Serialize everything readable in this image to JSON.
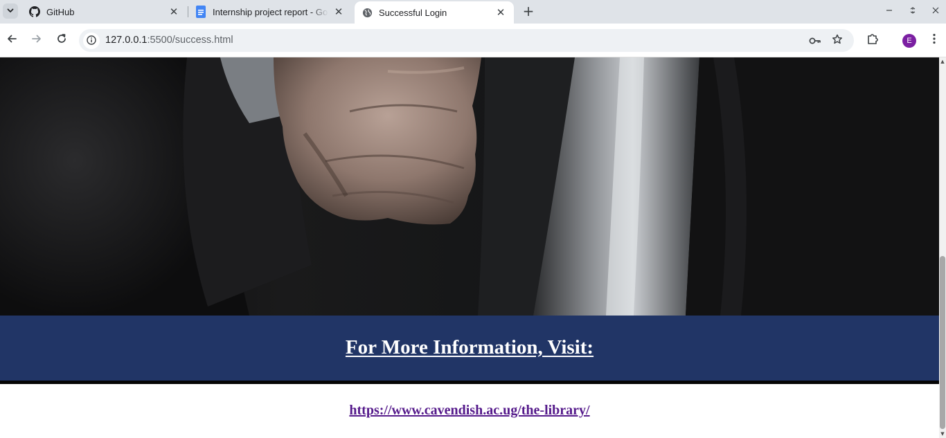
{
  "browser": {
    "tabs": [
      {
        "title": "GitHub",
        "icon": "github-icon",
        "active": false
      },
      {
        "title": "Internship project report - Go",
        "icon": "google-docs-icon",
        "active": false
      },
      {
        "title": "Successful Login",
        "icon": "globe-icon",
        "active": true
      }
    ],
    "new_tab_label": "+",
    "address": {
      "host": "127.0.0.1",
      "rest": ":5500/success.html"
    },
    "profile_initial": "E",
    "accent_profile_color": "#7b1fa2"
  },
  "page": {
    "hero_image": "dark-suit-clenched-fist-photo",
    "info_heading": "For More Information, Visit:",
    "info_link": "https://www.cavendish.ac.ug/the-library/",
    "colors": {
      "band": "#213566",
      "heading_text": "#ffffff",
      "link": "#551a8b"
    }
  }
}
